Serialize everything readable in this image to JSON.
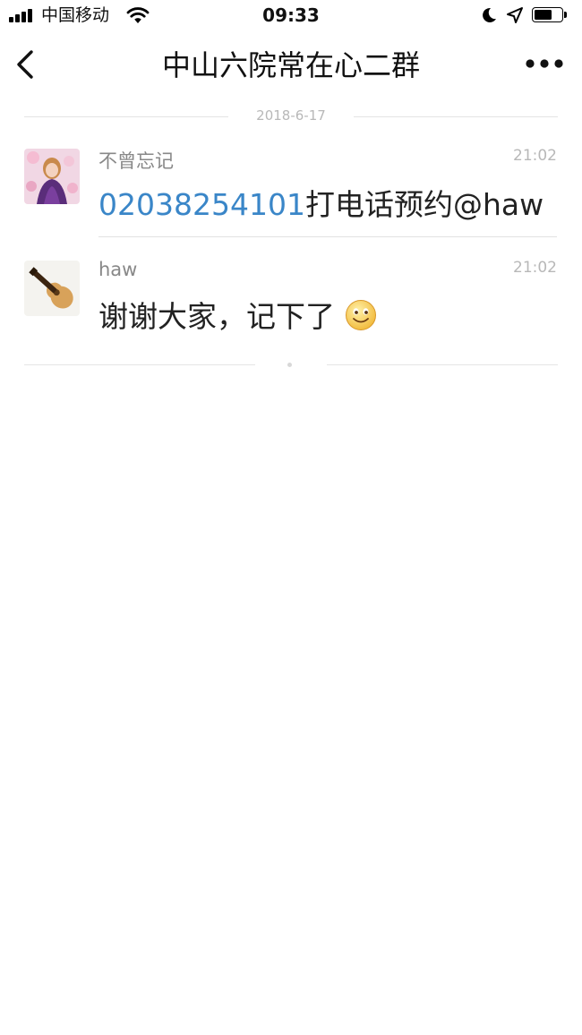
{
  "status_bar": {
    "carrier": "中国移动",
    "time": "09:33"
  },
  "nav": {
    "title": "中山六院常在心二群",
    "back_icon": "chevron-left-icon",
    "more_icon": "more-dots-icon"
  },
  "chat": {
    "date": "2018-6-17",
    "messages": [
      {
        "sender": "不曾忘记",
        "time": "21:02",
        "phone": "02038254101",
        "text": "打电话预约@haw",
        "avatar_icon": "avatar-photo"
      },
      {
        "sender": "haw",
        "time": "21:02",
        "text": "谢谢大家，记下了",
        "emoji_icon": "smile-emoji-icon",
        "avatar_icon": "ukulele-avatar"
      }
    ]
  },
  "colors": {
    "link": "#3a86c8",
    "meta": "#b8b8b8",
    "sender": "#888888"
  }
}
